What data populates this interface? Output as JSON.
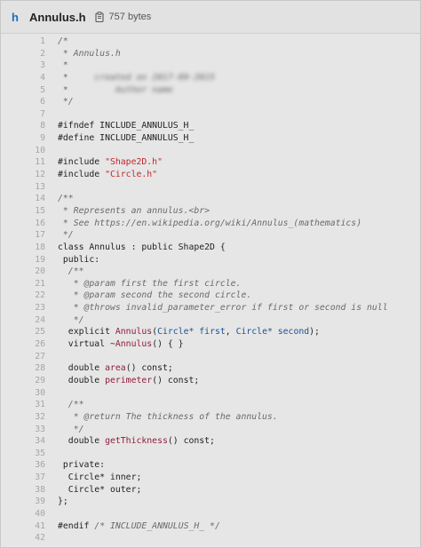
{
  "header": {
    "language_icon": "h",
    "file_name": "Annulus.h",
    "copy_icon": "clipboard-icon",
    "file_size": "757 bytes"
  },
  "code": {
    "lines": [
      {
        "n": "1",
        "t": "/*"
      },
      {
        "n": "2",
        "t": " * Annulus.h"
      },
      {
        "n": "3",
        "t": " *"
      },
      {
        "n": "4",
        "t": " *     created on 2017-09-2015"
      },
      {
        "n": "5",
        "t": " *         Author name"
      },
      {
        "n": "6",
        "t": " */"
      },
      {
        "n": "7",
        "t": ""
      },
      {
        "n": "8",
        "t": "#ifndef INCLUDE_ANNULUS_H_"
      },
      {
        "n": "9",
        "t": "#define INCLUDE_ANNULUS_H_"
      },
      {
        "n": "10",
        "t": ""
      },
      {
        "n": "11",
        "t": "#include \"Shape2D.h\""
      },
      {
        "n": "12",
        "t": "#include \"Circle.h\""
      },
      {
        "n": "13",
        "t": ""
      },
      {
        "n": "14",
        "t": "/**"
      },
      {
        "n": "15",
        "t": " * Represents an annulus.<br>"
      },
      {
        "n": "16",
        "t": " * See https://en.wikipedia.org/wiki/Annulus_(mathematics)"
      },
      {
        "n": "17",
        "t": " */"
      },
      {
        "n": "18",
        "t": "class Annulus : public Shape2D {"
      },
      {
        "n": "19",
        "t": " public:"
      },
      {
        "n": "20",
        "t": "  /**"
      },
      {
        "n": "21",
        "t": "   * @param first the first circle."
      },
      {
        "n": "22",
        "t": "   * @param second the second circle."
      },
      {
        "n": "23",
        "t": "   * @throws invalid_parameter_error if first or second is null"
      },
      {
        "n": "24",
        "t": "   */"
      },
      {
        "n": "25",
        "t": "  explicit Annulus(Circle* first, Circle* second);"
      },
      {
        "n": "26",
        "t": "  virtual ~Annulus() { }"
      },
      {
        "n": "27",
        "t": ""
      },
      {
        "n": "28",
        "t": "  double area() const;"
      },
      {
        "n": "29",
        "t": "  double perimeter() const;"
      },
      {
        "n": "30",
        "t": ""
      },
      {
        "n": "31",
        "t": "  /**"
      },
      {
        "n": "32",
        "t": "   * @return The thickness of the annulus."
      },
      {
        "n": "33",
        "t": "   */"
      },
      {
        "n": "34",
        "t": "  double getThickness() const;"
      },
      {
        "n": "35",
        "t": ""
      },
      {
        "n": "36",
        "t": " private:"
      },
      {
        "n": "37",
        "t": "  Circle* inner;"
      },
      {
        "n": "38",
        "t": "  Circle* outer;"
      },
      {
        "n": "39",
        "t": "};"
      },
      {
        "n": "40",
        "t": ""
      },
      {
        "n": "41",
        "t": "#endif /* INCLUDE_ANNULUS_H_ */"
      },
      {
        "n": "42",
        "t": ""
      }
    ]
  },
  "colors": {
    "keyword": "#111111",
    "string": "#c0282d",
    "function": "#8f1d3a",
    "type": "#1f4f93",
    "comment": "#6a6a6a",
    "line_number": "#a5a5a5"
  }
}
